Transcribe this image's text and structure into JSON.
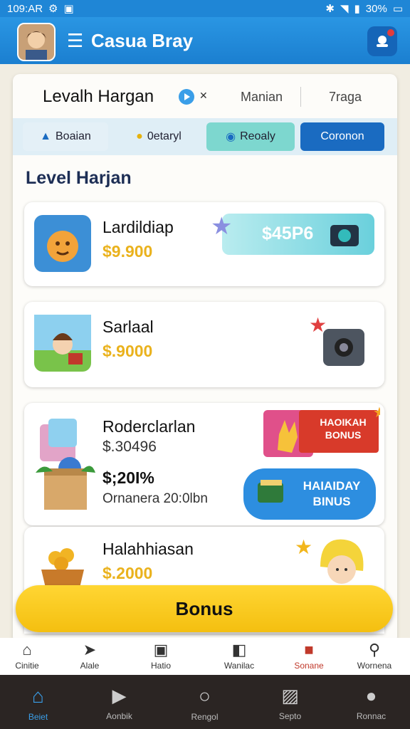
{
  "status": {
    "time": "109:AR",
    "battery": "30%"
  },
  "app": {
    "title": "Casua Bray"
  },
  "header": {
    "title": "Levalh Hargan",
    "link_m": "Manian",
    "link_t": "7raga"
  },
  "tabs": [
    "Boaian",
    "0etaryl",
    "Reoaly",
    "Coronon"
  ],
  "section_title": "Level Harjan",
  "items": [
    {
      "name": "Lardildiap",
      "price": "$9.900",
      "reward": "$45P6"
    },
    {
      "name": "Sarlaal",
      "price": "$.9000"
    },
    {
      "name": "Roderclarlan",
      "price": "$.30496",
      "percent": "$;20I%",
      "note": "Ornanera 20:0lbn",
      "banner1": "HAOIKAH BONUS",
      "banner2": "HAIAIDAY BINUS"
    },
    {
      "name": "Halahhiasan",
      "price": "$.2000"
    }
  ],
  "bonus_button": "Bonus",
  "nav_top": [
    "Cinitie",
    "Alale",
    "Hatio",
    "Wanilac",
    "Sonane",
    "Wornena"
  ],
  "nav_bottom": [
    "Beiet",
    "Aonbik",
    "Rengol",
    "Septo",
    "Ronnac"
  ],
  "colors": {
    "primary": "#1f86d6",
    "accent": "#f4bf10",
    "price": "#eab21d"
  }
}
